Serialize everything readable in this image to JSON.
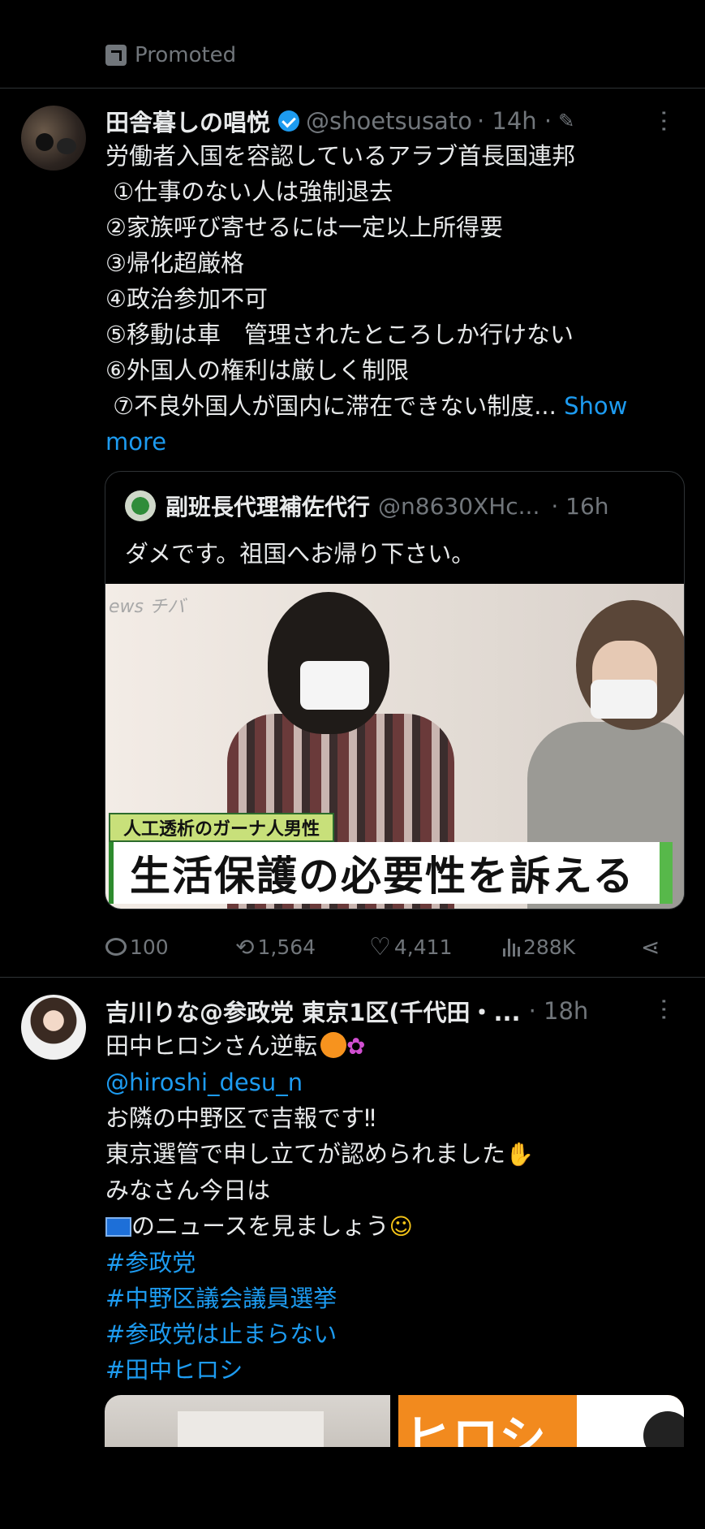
{
  "promoted": {
    "label": "Promoted"
  },
  "tweet1": {
    "name": "田舎暮しの唱悦",
    "handle": "@shoetsusato",
    "time": "· 14h ·",
    "lines": [
      "労働者入国を容認しているアラブ首長国連邦",
      " ①仕事のない人は強制退去",
      "②家族呼び寄せるには一定以上所得要",
      "③帰化超厳格",
      "④政治参加不可",
      "⑤移動は車　管理されたところしか行けない",
      "⑥外国人の権利は厳しく制限",
      " ⑦不良外国人が国内に滞在できない制度..."
    ],
    "show_more_a": "Show",
    "show_more_b": "more",
    "quote": {
      "name": "副班長代理補佐代行",
      "handle": "@n8630XHc...",
      "time": "· 16h",
      "text": "ダメです。祖国へお帰り下さい。",
      "image": {
        "watermark": "ews チバ",
        "caption_small": "人工透析のガーナ人男性",
        "caption_main": "生活保護の必要性を訴える"
      }
    },
    "stats": {
      "replies": "100",
      "retweets": "1,564",
      "likes": "4,411",
      "views": "288K"
    }
  },
  "tweet2": {
    "name": "吉川りな@参政党 東京1区(千代田・...",
    "time": "· 18h",
    "line1": "田中ヒロシさん逆転",
    "mention": "@hiroshi_desu_n",
    "line3": "お隣の中野区で吉報です‼︎",
    "line4": "東京選管で申し立てが認められました",
    "line5": "みなさん今日は",
    "line6": "のニュースを見ましょう",
    "hashtags": [
      "#参政党",
      "#中野区議会議員選挙",
      "#参政党は止まらない",
      "#田中ヒロシ"
    ],
    "media_text": "ヒロシ"
  }
}
